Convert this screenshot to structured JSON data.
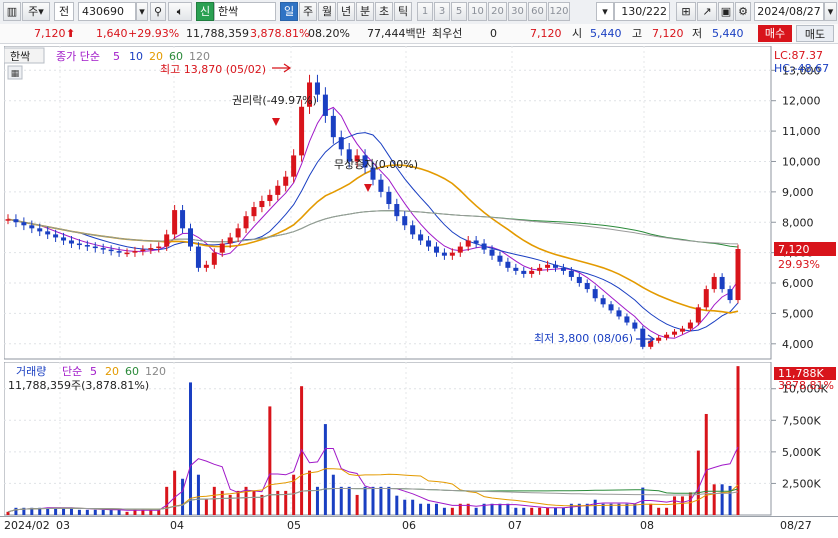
{
  "toolbar": {
    "market": "주",
    "prefix": "전",
    "code": "430690",
    "search_icon": "search-icon",
    "new_badge": "신",
    "stock_name": "한싹",
    "periods": [
      "일",
      "주",
      "월",
      "년",
      "분",
      "초",
      "틱"
    ],
    "selected_period": "일",
    "minutes": [
      "1",
      "3",
      "5",
      "10",
      "20",
      "30",
      "60",
      "120"
    ],
    "count": "130",
    "total": "/222",
    "date": "2024/08/27"
  },
  "quote": {
    "price": "7,120",
    "change": "1,640",
    "change_pct": "+29.93%",
    "volume": "11,788,359",
    "volume_pct": "3,878.81%",
    "turnover": "08.20%",
    "amount": "77,444백만",
    "fav_label": "최우선",
    "fav_value": "0",
    "last": "7,120",
    "open_label": "시",
    "open": "5,440",
    "high_label": "고",
    "high": "7,120",
    "low_label": "저",
    "low": "5,440",
    "buy_label": "매수",
    "sell_label": "매도"
  },
  "price_panel": {
    "name_tag": "한싹",
    "ma_title": "종가 단순",
    "ma_periods": [
      "5",
      "10",
      "20",
      "60",
      "120"
    ],
    "lc": "LC:87.37",
    "hc": "HC:-48.67",
    "y_ticks": [
      "13,000",
      "12,000",
      "11,000",
      "10,000",
      "9,000",
      "8,000",
      "7,000",
      "6,000",
      "5,000",
      "4,000"
    ],
    "current_price_tag": "7,120",
    "current_pct_tag": "29.93%",
    "high_note": "최고 13,870 (05/02)",
    "low_note": "최저 3,800 (08/06)",
    "event1": "권리락(-49.97%)",
    "event2": "무상증자(0.00%)"
  },
  "volume_panel": {
    "title": "거래량",
    "ma_title": "단순",
    "ma_periods": [
      "5",
      "20",
      "60",
      "120"
    ],
    "summary": "11,788,359주(3,878.81%)",
    "y_ticks": [
      "10,000K",
      "7,500K",
      "5,000K",
      "2,500K"
    ],
    "current_tag": "11,788K",
    "current_pct": "3878.81%"
  },
  "x_axis": {
    "labels": [
      "2024/02",
      "03",
      "04",
      "05",
      "06",
      "07",
      "08"
    ],
    "right_label": "08/27"
  },
  "chart_data": {
    "type": "candlestick",
    "price_ylim": [
      3500,
      13800
    ],
    "volume_ylim": [
      0,
      11800
    ],
    "approx_closes": [
      8100,
      8000,
      7900,
      7800,
      7700,
      7600,
      7500,
      7400,
      7300,
      7250,
      7200,
      7150,
      7100,
      7050,
      7000,
      7000,
      7050,
      7100,
      7150,
      7200,
      7600,
      8400,
      7800,
      7200,
      6500,
      6600,
      7000,
      7300,
      7500,
      7800,
      8200,
      8500,
      8700,
      8900,
      9200,
      9500,
      10200,
      11800,
      12600,
      12200,
      11500,
      10800,
      10400,
      10000,
      10200,
      9800,
      9400,
      9000,
      8600,
      8200,
      7900,
      7600,
      7400,
      7200,
      7000,
      6900,
      7000,
      7200,
      7400,
      7300,
      7100,
      6900,
      6700,
      6500,
      6400,
      6300,
      6400,
      6500,
      6600,
      6500,
      6400,
      6200,
      6000,
      5800,
      5500,
      5300,
      5100,
      4900,
      4700,
      4500,
      3900,
      4100,
      4200,
      4300,
      4400,
      4500,
      4700,
      5200,
      5800,
      6200,
      5800,
      5440,
      7120
    ],
    "volume_spikes_k": {
      "04_early": 10500,
      "04_mid": 8600,
      "04_late": 10200,
      "05_early": 7200,
      "08_late_a": 5100,
      "08_late_b": 8000,
      "08_27": 11788
    }
  }
}
